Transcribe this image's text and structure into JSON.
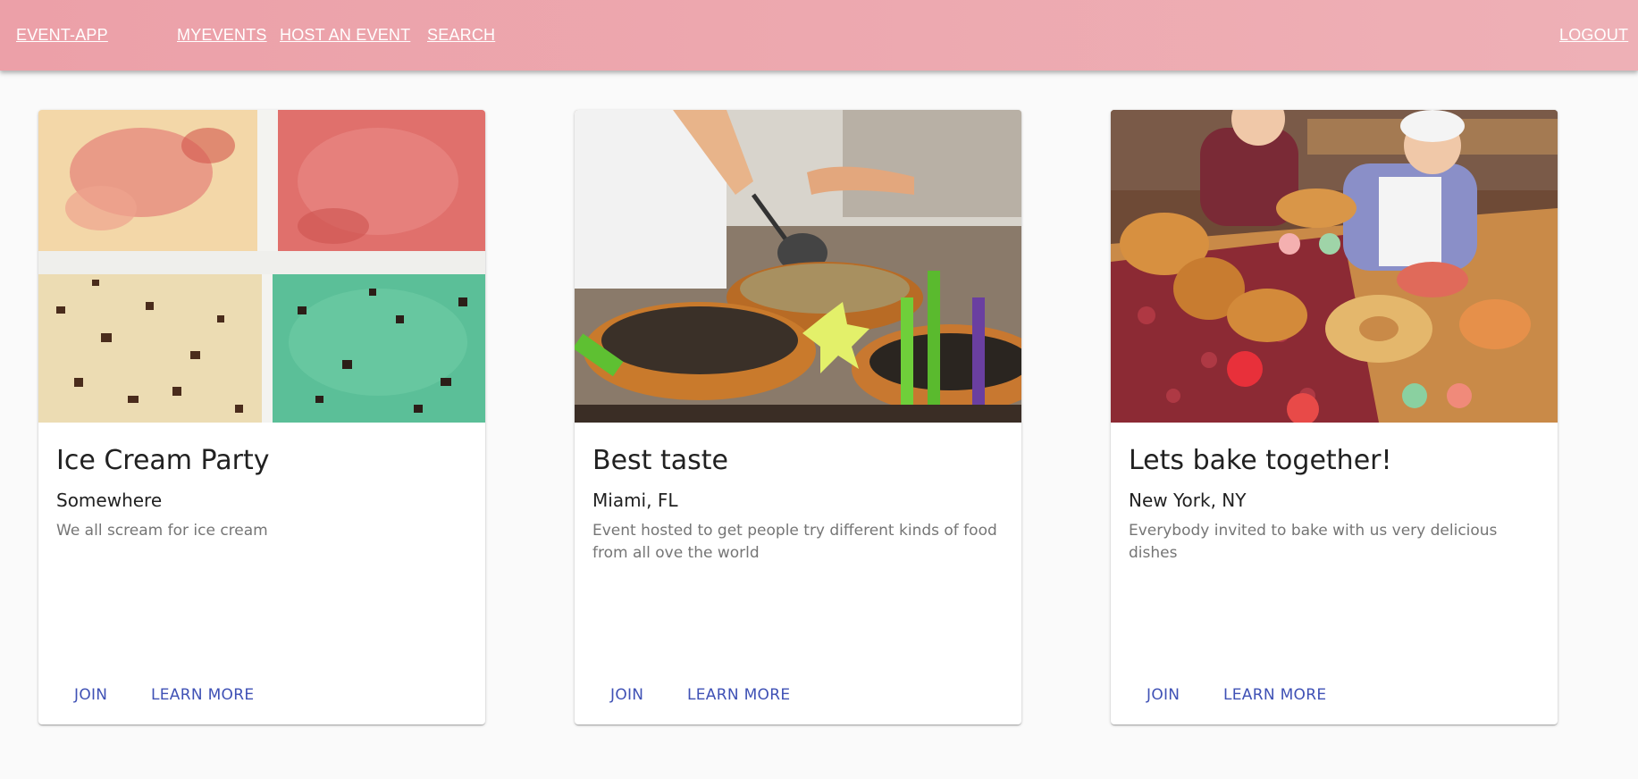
{
  "appbar": {
    "brand": "EVENT-APP",
    "nav": [
      "MYEVENTS",
      "HOST AN EVENT",
      "SEARCH"
    ],
    "logout": "LOGOUT",
    "color": "#eca0a8"
  },
  "cards": [
    {
      "title": "Ice Cream Party",
      "location": "Somewhere",
      "description": "We all scream for ice cream",
      "join": "JOIN",
      "learn_more": "LEARN MORE"
    },
    {
      "title": "Best taste",
      "location": "Miami, FL",
      "description": "Event hosted to get people try different kinds of food from all ove the world",
      "join": "JOIN",
      "learn_more": "LEARN MORE"
    },
    {
      "title": "Lets bake together!",
      "location": "New York, NY",
      "description": "Everybody invited to bake with us very delicious dishes",
      "join": "JOIN",
      "learn_more": "LEARN MORE"
    }
  ],
  "accent": "#3f51b5"
}
